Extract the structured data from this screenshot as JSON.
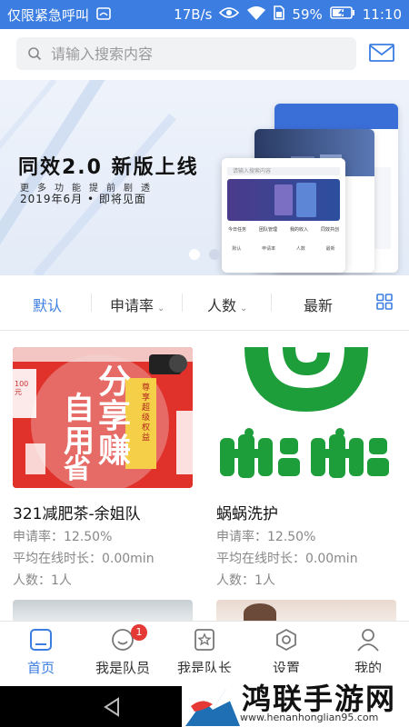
{
  "statusbar": {
    "carrier": "仅限紧急呼叫",
    "speed": "17B/s",
    "battery": "59%",
    "time": "11:10"
  },
  "search": {
    "placeholder": "请输入搜索内容"
  },
  "banner": {
    "title": "同效2.0 新版上线",
    "subtitle": "更多功能提前剧透",
    "date": "2019年6月 • 即将见面",
    "phone_search": "请输入搜索内容",
    "phone_features": [
      "今日任务",
      "团队管理",
      "我的收入",
      "同效共创"
    ],
    "phone_tabs": [
      "默认",
      "申请率",
      "人数",
      "最新"
    ]
  },
  "filters": {
    "default": "默认",
    "rate": "申请率",
    "people": "人数",
    "latest": "最新"
  },
  "cards": [
    {
      "name": "321减肥茶-余姐队",
      "rate": "申请率：12.50%",
      "online": "平均在线时长：0.00min",
      "people": "人数：1人",
      "art": {
        "big1": "自",
        "big2": "用",
        "big3": "省",
        "big4": "分",
        "big5": "享",
        "big6": "赚",
        "tag": "尊享 超级权益",
        "coupon": "100元"
      }
    },
    {
      "name": "蜗蜗洗护",
      "rate": "申请率：12.50%",
      "online": "平均在线时长：0.00min",
      "people": "人数：1人"
    }
  ],
  "tabs": [
    {
      "label": "首页"
    },
    {
      "label": "我是队员",
      "badge": "1"
    },
    {
      "label": "我是队长"
    },
    {
      "label": "设置"
    },
    {
      "label": "我的"
    }
  ],
  "watermark": {
    "main": "鸿联手游网",
    "url": "www.henanhonglian95.com"
  },
  "colors": {
    "accent": "#3b7de0",
    "statusbar": "#3b7de0",
    "badge": "#e53935",
    "card1_bg": "#e0312b",
    "card2_logo": "#1e9e3a"
  }
}
